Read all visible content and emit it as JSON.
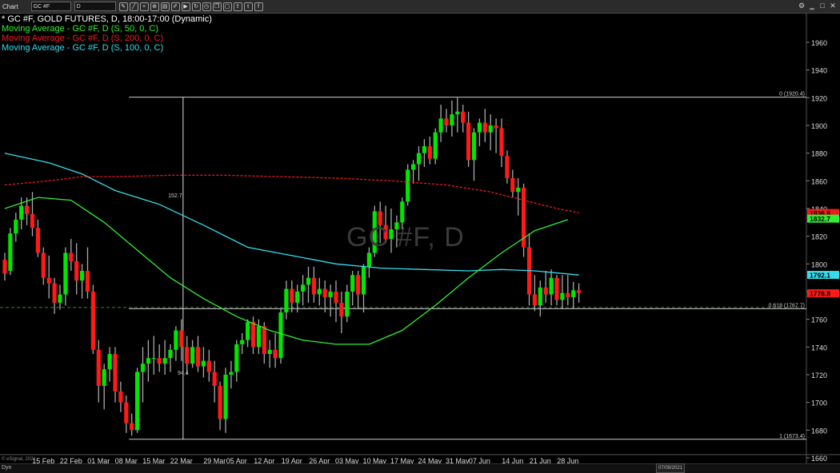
{
  "toolbar": {
    "title": "Chart",
    "symbol": "GC #F",
    "period": "D"
  },
  "legend": {
    "main": "* GC #F, GOLD FUTURES, D, 18:00-17:00 (Dynamic)",
    "ma50": "Moving Average - GC #F, D (S, 50, 0, C)",
    "ma200": "Moving Average - GC #F, D (S, 200, 0, C)",
    "ma100": "Moving Average - GC #F, D (S, 100, 0, C)"
  },
  "watermark": "GC #F, D",
  "footer": {
    "copyright": "© eSignal, 2021",
    "dyn": "Dyn",
    "date_box": "07/09/2021"
  },
  "colors": {
    "up": "#00e600",
    "down": "#ff1a1a",
    "ma50": "#33ee33",
    "ma200": "#ee1c1c",
    "ma100": "#33ddee",
    "fib": "#cccccc"
  },
  "chart_data": {
    "type": "candlestick",
    "title": "GC #F, GOLD FUTURES, D, 18:00-17:00 (Dynamic)",
    "ylim": [
      1650,
      1990
    ],
    "y_ticks": [
      1660,
      1680,
      1700,
      1720,
      1740,
      1760,
      1780,
      1800,
      1820,
      1840,
      1860,
      1880,
      1900,
      1920,
      1940,
      1960
    ],
    "x_tick_labels": [
      "15 Feb",
      "22 Feb",
      "01 Mar",
      "08 Mar",
      "15 Mar",
      "22 Mar",
      "29 Mar",
      "05 Apr",
      "12 Apr",
      "19 Apr",
      "26 Apr",
      "03 May",
      "10 May",
      "17 May",
      "24 May",
      "31 May",
      "07 Jun",
      "14 Jun",
      "21 Jun",
      "28 Jun"
    ],
    "x_tick_index": [
      7,
      12,
      17,
      22,
      27,
      32,
      38,
      42,
      47,
      52,
      57,
      62,
      67,
      72,
      77,
      82,
      86,
      92,
      97,
      102
    ],
    "ohlc": [
      [
        1803,
        1808,
        1788,
        1793
      ],
      [
        1795,
        1826,
        1792,
        1822
      ],
      [
        1822,
        1837,
        1816,
        1832
      ],
      [
        1832,
        1848,
        1825,
        1842
      ],
      [
        1842,
        1848,
        1828,
        1836
      ],
      [
        1836,
        1852,
        1820,
        1826
      ],
      [
        1826,
        1832,
        1805,
        1808
      ],
      [
        1808,
        1812,
        1785,
        1790
      ],
      [
        1790,
        1806,
        1775,
        1786
      ],
      [
        1786,
        1790,
        1764,
        1772
      ],
      [
        1772,
        1785,
        1767,
        1778
      ],
      [
        1778,
        1812,
        1770,
        1808
      ],
      [
        1808,
        1818,
        1795,
        1802
      ],
      [
        1802,
        1815,
        1778,
        1788
      ],
      [
        1788,
        1800,
        1775,
        1795
      ],
      [
        1795,
        1812,
        1775,
        1780
      ],
      [
        1780,
        1785,
        1735,
        1738
      ],
      [
        1738,
        1745,
        1700,
        1712
      ],
      [
        1712,
        1728,
        1695,
        1724
      ],
      [
        1724,
        1740,
        1715,
        1735
      ],
      [
        1735,
        1740,
        1700,
        1708
      ],
      [
        1708,
        1715,
        1693,
        1700
      ],
      [
        1700,
        1705,
        1678,
        1685
      ],
      [
        1685,
        1692,
        1676,
        1680
      ],
      [
        1680,
        1725,
        1678,
        1722
      ],
      [
        1722,
        1740,
        1700,
        1728
      ],
      [
        1728,
        1745,
        1715,
        1732
      ],
      [
        1732,
        1748,
        1720,
        1732
      ],
      [
        1732,
        1742,
        1722,
        1728
      ],
      [
        1728,
        1745,
        1720,
        1732
      ],
      [
        1732,
        1742,
        1722,
        1738
      ],
      [
        1738,
        1755,
        1730,
        1752
      ],
      [
        1752,
        1760,
        1730,
        1740
      ],
      [
        1740,
        1748,
        1720,
        1728
      ],
      [
        1728,
        1745,
        1725,
        1740
      ],
      [
        1740,
        1748,
        1722,
        1726
      ],
      [
        1726,
        1740,
        1718,
        1730
      ],
      [
        1730,
        1738,
        1715,
        1722
      ],
      [
        1722,
        1730,
        1700,
        1712
      ],
      [
        1712,
        1715,
        1680,
        1688
      ],
      [
        1688,
        1725,
        1678,
        1720
      ],
      [
        1720,
        1730,
        1710,
        1722
      ],
      [
        1722,
        1745,
        1715,
        1742
      ],
      [
        1742,
        1750,
        1735,
        1745
      ],
      [
        1745,
        1760,
        1740,
        1758
      ],
      [
        1758,
        1762,
        1735,
        1740
      ],
      [
        1740,
        1760,
        1735,
        1755
      ],
      [
        1755,
        1758,
        1728,
        1735
      ],
      [
        1735,
        1745,
        1725,
        1738
      ],
      [
        1738,
        1750,
        1725,
        1732
      ],
      [
        1732,
        1768,
        1728,
        1765
      ],
      [
        1765,
        1788,
        1760,
        1782
      ],
      [
        1782,
        1788,
        1765,
        1772
      ],
      [
        1772,
        1785,
        1765,
        1780
      ],
      [
        1780,
        1792,
        1770,
        1785
      ],
      [
        1785,
        1798,
        1772,
        1790
      ],
      [
        1790,
        1798,
        1772,
        1778
      ],
      [
        1778,
        1790,
        1770,
        1782
      ],
      [
        1782,
        1788,
        1765,
        1776
      ],
      [
        1776,
        1785,
        1762,
        1780
      ],
      [
        1780,
        1788,
        1758,
        1772
      ],
      [
        1772,
        1780,
        1750,
        1762
      ],
      [
        1762,
        1785,
        1758,
        1780
      ],
      [
        1780,
        1795,
        1770,
        1792
      ],
      [
        1792,
        1795,
        1768,
        1778
      ],
      [
        1778,
        1800,
        1765,
        1798
      ],
      [
        1798,
        1812,
        1790,
        1808
      ],
      [
        1808,
        1842,
        1805,
        1838
      ],
      [
        1838,
        1845,
        1815,
        1828
      ],
      [
        1828,
        1842,
        1815,
        1818
      ],
      [
        1818,
        1840,
        1808,
        1825
      ],
      [
        1825,
        1835,
        1812,
        1830
      ],
      [
        1830,
        1848,
        1825,
        1845
      ],
      [
        1845,
        1872,
        1842,
        1868
      ],
      [
        1868,
        1875,
        1858,
        1872
      ],
      [
        1872,
        1885,
        1860,
        1880
      ],
      [
        1880,
        1890,
        1870,
        1885
      ],
      [
        1885,
        1892,
        1872,
        1876
      ],
      [
        1876,
        1898,
        1872,
        1895
      ],
      [
        1895,
        1915,
        1888,
        1905
      ],
      [
        1905,
        1912,
        1895,
        1900
      ],
      [
        1900,
        1918,
        1892,
        1908
      ],
      [
        1908,
        1920,
        1895,
        1910
      ],
      [
        1910,
        1915,
        1895,
        1902
      ],
      [
        1902,
        1910,
        1870,
        1875
      ],
      [
        1875,
        1898,
        1860,
        1895
      ],
      [
        1895,
        1905,
        1885,
        1902
      ],
      [
        1902,
        1912,
        1888,
        1895
      ],
      [
        1895,
        1908,
        1882,
        1900
      ],
      [
        1900,
        1905,
        1880,
        1898
      ],
      [
        1898,
        1905,
        1870,
        1878
      ],
      [
        1878,
        1882,
        1858,
        1862
      ],
      [
        1862,
        1868,
        1848,
        1852
      ],
      [
        1852,
        1862,
        1835,
        1855
      ],
      [
        1855,
        1858,
        1805,
        1812
      ],
      [
        1812,
        1822,
        1770,
        1778
      ],
      [
        1778,
        1792,
        1766,
        1770
      ],
      [
        1770,
        1788,
        1762,
        1783
      ],
      [
        1783,
        1795,
        1772,
        1778
      ],
      [
        1778,
        1796,
        1770,
        1790
      ],
      [
        1790,
        1792,
        1770,
        1774
      ],
      [
        1774,
        1792,
        1768,
        1779
      ],
      [
        1779,
        1792,
        1770,
        1776
      ],
      [
        1776,
        1787,
        1768,
        1781
      ],
      [
        1781,
        1786,
        1772,
        1779
      ]
    ],
    "ma50_points": [
      [
        0,
        1840
      ],
      [
        6,
        1848
      ],
      [
        12,
        1846
      ],
      [
        18,
        1830
      ],
      [
        24,
        1810
      ],
      [
        30,
        1790
      ],
      [
        36,
        1775
      ],
      [
        42,
        1762
      ],
      [
        48,
        1752
      ],
      [
        54,
        1745
      ],
      [
        60,
        1742
      ],
      [
        66,
        1742
      ],
      [
        72,
        1752
      ],
      [
        78,
        1770
      ],
      [
        84,
        1790
      ],
      [
        90,
        1808
      ],
      [
        96,
        1824
      ],
      [
        102,
        1832
      ]
    ],
    "ma200_points": [
      [
        0,
        1857
      ],
      [
        8,
        1860
      ],
      [
        14,
        1863
      ],
      [
        20,
        1863
      ],
      [
        30,
        1864
      ],
      [
        40,
        1864
      ],
      [
        50,
        1863
      ],
      [
        60,
        1862
      ],
      [
        70,
        1860
      ],
      [
        80,
        1857
      ],
      [
        88,
        1852
      ],
      [
        94,
        1846
      ],
      [
        100,
        1840
      ],
      [
        104,
        1837
      ]
    ],
    "ma100_points": [
      [
        0,
        1880
      ],
      [
        8,
        1873
      ],
      [
        14,
        1865
      ],
      [
        20,
        1853
      ],
      [
        28,
        1843
      ],
      [
        36,
        1828
      ],
      [
        44,
        1812
      ],
      [
        52,
        1806
      ],
      [
        60,
        1800
      ],
      [
        68,
        1797
      ],
      [
        76,
        1796
      ],
      [
        84,
        1795
      ],
      [
        90,
        1796
      ],
      [
        96,
        1795
      ],
      [
        104,
        1792
      ]
    ],
    "fib_levels": [
      {
        "label": "0 (1920.4)",
        "value": 1920.4
      },
      {
        "label": "0.618 (1767.7)",
        "value": 1767.7
      },
      {
        "label": "1 (1673.4)",
        "value": 1673.4
      }
    ],
    "fib_range_label": "152.7",
    "fib_mid_label": "94.4",
    "price_tags": [
      {
        "label": "1836.8",
        "value": 1836.8,
        "color": "#ee1c1c"
      },
      {
        "label": "1832.7",
        "value": 1832.7,
        "color": "#33ee33"
      },
      {
        "label": "1792.1",
        "value": 1792.1,
        "color": "#33ddee"
      },
      {
        "label": "1778.8",
        "value": 1778.8,
        "color": "#ff1a1a"
      }
    ],
    "dashed_level": 1768.5
  }
}
